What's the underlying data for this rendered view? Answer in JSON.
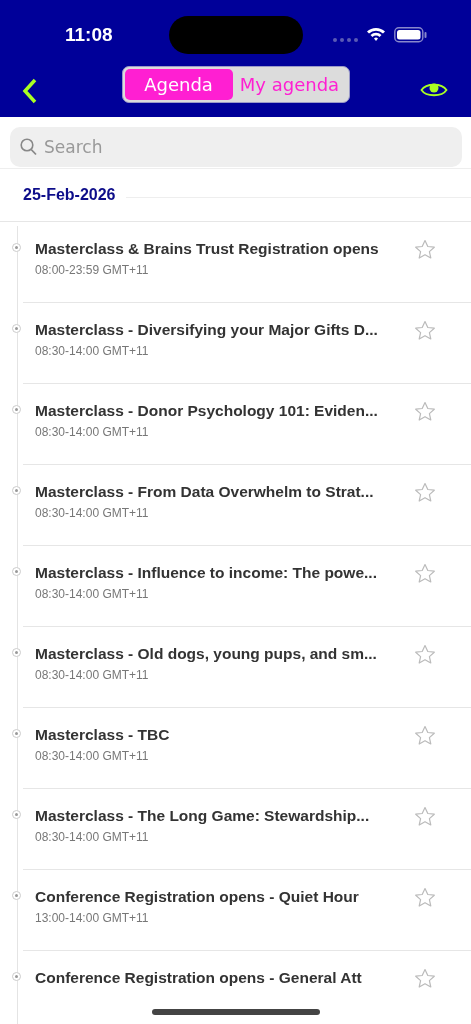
{
  "status_bar": {
    "time": "11:08"
  },
  "nav": {
    "tabs": [
      {
        "label": "Agenda",
        "selected": true
      },
      {
        "label": "My agenda",
        "selected": false
      }
    ]
  },
  "search": {
    "placeholder": "Search"
  },
  "date": "25-Feb-2026",
  "sessions": [
    {
      "title": "Masterclass & Brains Trust Registration opens",
      "time": "08:00-23:59 GMT+11",
      "starred": false
    },
    {
      "title": "Masterclass - Diversifying your Major Gifts D...",
      "time": "08:30-14:00 GMT+11",
      "starred": false
    },
    {
      "title": "Masterclass - Donor Psychology 101: Eviden...",
      "time": "08:30-14:00 GMT+11",
      "starred": false
    },
    {
      "title": "Masterclass - From Data Overwhelm to Strat...",
      "time": "08:30-14:00 GMT+11",
      "starred": false
    },
    {
      "title": "Masterclass - Influence to income: The powe...",
      "time": "08:30-14:00 GMT+11",
      "starred": false
    },
    {
      "title": "Masterclass - Old dogs, young pups, and sm...",
      "time": "08:30-14:00 GMT+11",
      "starred": false
    },
    {
      "title": "Masterclass - TBC",
      "time": "08:30-14:00 GMT+11",
      "starred": false
    },
    {
      "title": "Masterclass - The Long Game: Stewardship...",
      "time": "08:30-14:00 GMT+11",
      "starred": false
    },
    {
      "title": "Conference Registration opens - Quiet Hour",
      "time": "13:00-14:00 GMT+11",
      "starred": false
    },
    {
      "title": "Conference Registration opens - General Att",
      "starred": false
    }
  ]
}
